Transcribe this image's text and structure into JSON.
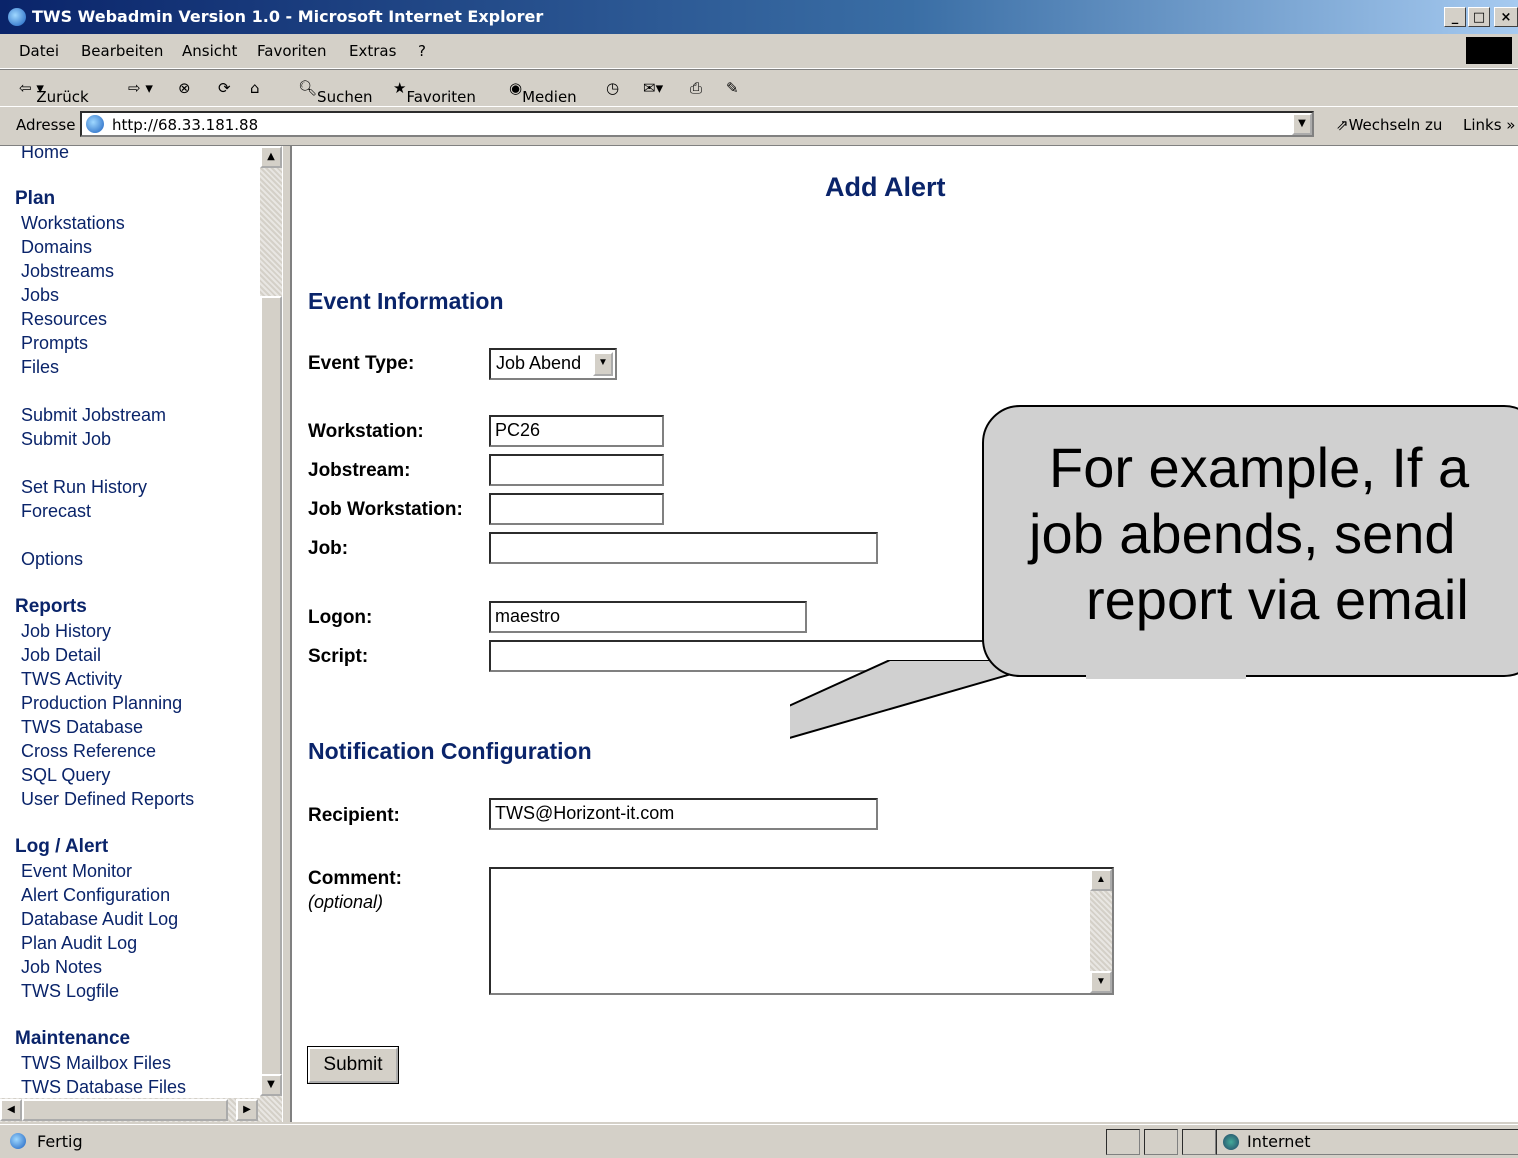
{
  "window": {
    "title": "TWS Webadmin Version 1.0 - Microsoft Internet Explorer",
    "min": "_",
    "max": "□",
    "close": "×"
  },
  "menu": [
    "Datei",
    "Bearbeiten",
    "Ansicht",
    "Favoriten",
    "Extras",
    "?"
  ],
  "toolbar": {
    "back": "Zurück",
    "search": "Suchen",
    "favorites": "Favoriten",
    "media": "Medien"
  },
  "address": {
    "label": "Adresse",
    "url": "http://68.33.181.88",
    "go": "Wechseln zu",
    "links": "Links »"
  },
  "sidebar": {
    "home": "Home",
    "plan": {
      "heading": "Plan",
      "items": [
        "Workstations",
        "Domains",
        "Jobstreams",
        "Jobs",
        "Resources",
        "Prompts",
        "Files"
      ]
    },
    "submit": [
      "Submit Jobstream",
      "Submit Job"
    ],
    "history": [
      "Set Run History",
      "Forecast"
    ],
    "options": "Options",
    "reports": {
      "heading": "Reports",
      "items": [
        "Job History",
        "Job Detail",
        "TWS Activity",
        "Production Planning",
        "TWS Database",
        "Cross Reference",
        "SQL Query",
        "User Defined Reports"
      ]
    },
    "log": {
      "heading": "Log / Alert",
      "items": [
        "Event Monitor",
        "Alert Configuration",
        "Database Audit Log",
        "Plan Audit Log",
        "Job Notes",
        "TWS Logfile"
      ]
    },
    "maintenance": {
      "heading": "Maintenance",
      "items": [
        "TWS Mailbox Files",
        "TWS Database Files"
      ]
    }
  },
  "main": {
    "title": "Add Alert",
    "event_section": "Event Information",
    "event_type_label": "Event Type:",
    "event_type_value": "Job Abend",
    "workstation_label": "Workstation:",
    "workstation_value": "PC26",
    "jobstream_label": "Jobstream:",
    "jobstream_value": "",
    "job_workstation_label": "Job Workstation:",
    "job_workstation_value": "",
    "job_label": "Job:",
    "job_value": "",
    "logon_label": "Logon:",
    "logon_value": "maestro",
    "script_label": "Script:",
    "script_value": "",
    "notification_section": "Notification Configuration",
    "recipient_label": "Recipient:",
    "recipient_value": "TWS@Horizont-it.com",
    "comment_label": "Comment:",
    "comment_hint": "(optional)",
    "submit": "Submit"
  },
  "callout": {
    "line1": "For example, If a",
    "line2": "job abends, send",
    "line3": "report via email"
  },
  "status": {
    "text": "Fertig",
    "zone": "Internet"
  }
}
